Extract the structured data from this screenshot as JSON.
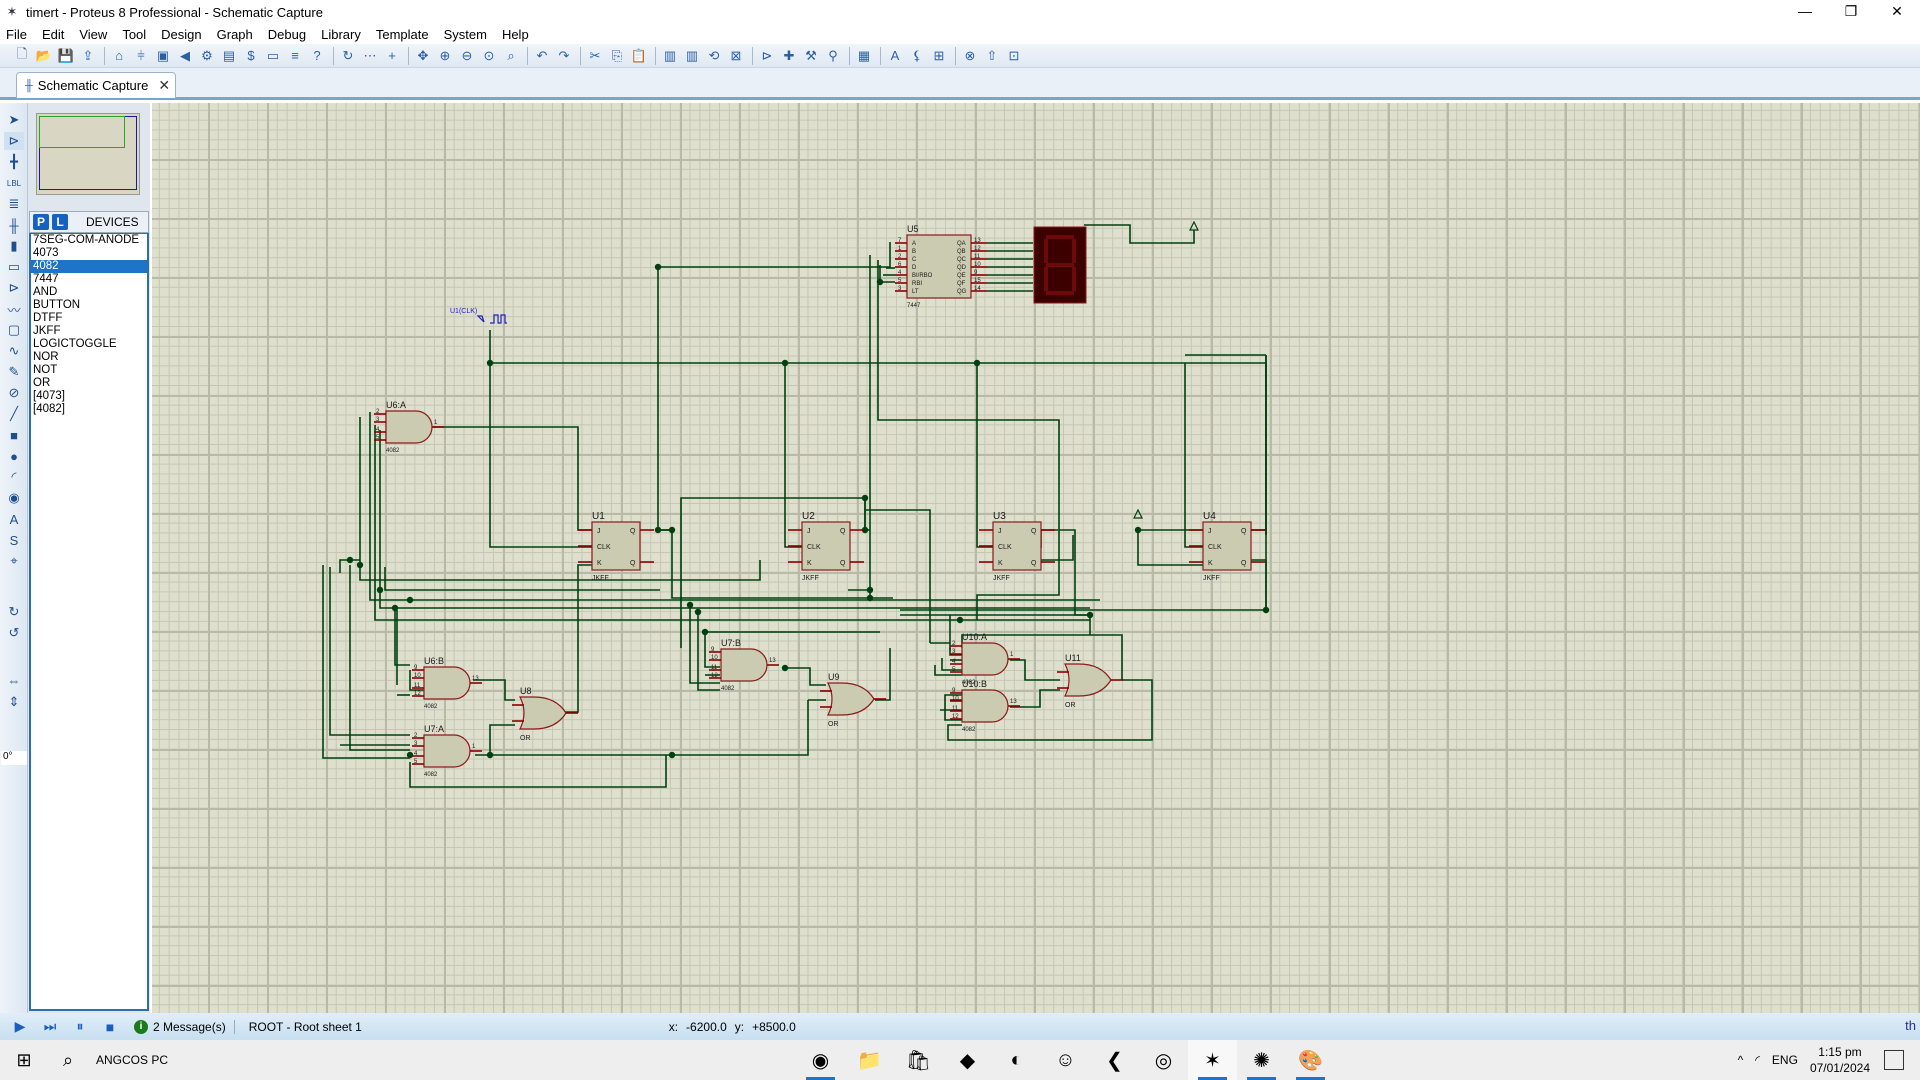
{
  "window": {
    "title": "timert - Proteus 8 Professional - Schematic Capture",
    "minimize": "—",
    "restore": "❐",
    "close": "✕"
  },
  "menu": [
    "File",
    "Edit",
    "View",
    "Tool",
    "Design",
    "Graph",
    "Debug",
    "Library",
    "Template",
    "System",
    "Help"
  ],
  "toolbar": {
    "icons": [
      "new-icon",
      "open-icon",
      "save-icon",
      "import-icon",
      "home-icon",
      "schematic-icon",
      "pcb-icon",
      "3d-icon",
      "gerber-icon",
      "bom-icon",
      "design-notes-icon",
      "design-explorer-icon",
      "report-icon",
      "help-icon",
      "refresh-icon",
      "grid-icon",
      "origin-icon",
      "pan-icon",
      "zoom-in-icon",
      "zoom-out-icon",
      "zoom-all-icon",
      "zoom-area-icon",
      "undo-icon",
      "redo-icon",
      "cut-icon",
      "copy-icon",
      "paste-icon",
      "block-copy-icon",
      "block-move-icon",
      "block-rotate-icon",
      "block-delete-icon",
      "pick-device-icon",
      "make-device-icon",
      "packaging-tool-icon",
      "decompose-icon",
      "wire-autorouter-icon",
      "search-tag-icon",
      "property-assign-icon",
      "new-sheet-icon",
      "remove-sheet-icon",
      "exit-parent-icon",
      "netlist-icon"
    ],
    "glyphs": [
      "🗋",
      "📂",
      "💾",
      "⇪",
      "⌂",
      "⫩",
      "▣",
      "◀",
      "⚙",
      "▤",
      "$",
      "▭",
      "≡",
      "?",
      "↻",
      "⋯",
      "+",
      "✥",
      "⊕",
      "⊖",
      "⊙",
      "⌕",
      "↶",
      "↷",
      "✂",
      "⎘",
      "📋",
      "▥",
      "▥",
      "⟲",
      "⊠",
      "⊳",
      "✚",
      "⚒",
      "⚲",
      "▦",
      "A",
      "⚸",
      "⊞",
      "⊗",
      "⇧",
      "⊡"
    ]
  },
  "tab": {
    "label": "Schematic Capture",
    "close": "✕"
  },
  "left_tools": [
    "selection-mode-icon",
    "component-mode-icon",
    "junction-dot-icon",
    "wire-label-icon",
    "text-script-icon",
    "bus-icon",
    "subcircuit-icon",
    "terminals-icon",
    "device-pins-icon",
    "graph-icon",
    "active-popup-icon",
    "generator-icon",
    "voltage-probe-icon",
    "virtual-instrument-icon",
    "2d-line-icon",
    "2d-box-icon",
    "2d-circle-icon",
    "2d-arc-icon",
    "2d-path-icon",
    "2d-text-icon",
    "2d-symbol-icon",
    "2d-marker-icon",
    "rotate-cw-icon",
    "rotate-ccw-icon",
    "mirror-x-icon",
    "mirror-y-icon"
  ],
  "left_tool_glyphs": [
    "➤",
    "⊳",
    "╋",
    "LBL",
    "≣",
    "╫",
    "▮",
    "▭",
    "⊳",
    "〰",
    "▢",
    "∿",
    "✎",
    "⊘",
    "╱",
    "■",
    "●",
    "◜",
    "◉",
    "A",
    "S",
    "⌖",
    "↻",
    "↺",
    "⇔",
    "⇕"
  ],
  "rotation": "0°",
  "devices": {
    "p_button": "P",
    "l_button": "L",
    "header": "DEVICES",
    "items": [
      "7SEG-COM-ANODE",
      "4073",
      "4082",
      "7447",
      "AND",
      "BUTTON",
      "DTFF",
      "JKFF",
      "LOGICTOGGLE",
      "NOR",
      "NOT",
      "OR",
      "[4073]",
      "[4082]"
    ],
    "selected": "4082"
  },
  "schematic": {
    "clock_label": "U1(CLK)",
    "flipflops": [
      {
        "ref": "U1",
        "type": "JKFF"
      },
      {
        "ref": "U2",
        "type": "JKFF"
      },
      {
        "ref": "U3",
        "type": "JKFF"
      },
      {
        "ref": "U4",
        "type": "JKFF"
      }
    ],
    "ff_pins": {
      "j": "J",
      "clk": "CLK",
      "k": "K",
      "q": "Q",
      "qbar": "Q"
    },
    "and_gates": [
      {
        "ref": "U6:A",
        "type": "4082",
        "pins": [
          "2",
          "3",
          "4",
          "5"
        ],
        "out": "1"
      },
      {
        "ref": "U6:B",
        "type": "4082",
        "pins": [
          "9",
          "10",
          "11",
          "12"
        ],
        "out": "13"
      },
      {
        "ref": "U7:A",
        "type": "4082",
        "pins": [
          "2",
          "3",
          "4",
          "5"
        ],
        "out": "1"
      },
      {
        "ref": "U7:B",
        "type": "4082",
        "pins": [
          "9",
          "10",
          "11",
          "12"
        ],
        "out": "13"
      },
      {
        "ref": "U10:A",
        "type": "4082",
        "pins": [
          "2",
          "3",
          "4",
          "5"
        ],
        "out": "1"
      },
      {
        "ref": "U10:B",
        "type": "4082",
        "pins": [
          "9",
          "10",
          "11",
          "12"
        ],
        "out": "13"
      }
    ],
    "or_gates": [
      {
        "ref": "U8",
        "type": "OR"
      },
      {
        "ref": "U9",
        "type": "OR"
      },
      {
        "ref": "U11",
        "type": "OR"
      }
    ],
    "decoder": {
      "ref": "U5",
      "type": "7447",
      "inputs": [
        {
          "n": "7",
          "l": "A"
        },
        {
          "n": "1",
          "l": "B"
        },
        {
          "n": "2",
          "l": "C"
        },
        {
          "n": "6",
          "l": "D"
        },
        {
          "n": "4",
          "l": "BI/RBO"
        },
        {
          "n": "5",
          "l": "RBI"
        },
        {
          "n": "3",
          "l": "LT"
        }
      ],
      "outputs": [
        {
          "n": "13",
          "l": "QA"
        },
        {
          "n": "12",
          "l": "QB"
        },
        {
          "n": "11",
          "l": "QC"
        },
        {
          "n": "10",
          "l": "QD"
        },
        {
          "n": "9",
          "l": "QE"
        },
        {
          "n": "15",
          "l": "QF"
        },
        {
          "n": "14",
          "l": "QG"
        }
      ]
    },
    "display": {
      "type": "7SEG-COM-ANODE"
    },
    "colors": {
      "wire": "#00400f",
      "pin": "#8b0000",
      "body": "#cbcbb1",
      "outline": "#8b1a1a",
      "label": "#1a1a1a",
      "probe": "#2020c0",
      "display_bg": "#3c0000",
      "segment": "#6a0a0a"
    }
  },
  "status": {
    "messages": "2 Message(s)",
    "sheet": "ROOT - Root sheet 1",
    "x_label": "x:",
    "x_value": "-6200.0",
    "y_label": "y:",
    "y_value": "+8500.0",
    "units": "th"
  },
  "taskbar": {
    "pc_name": "ANGCOS PC",
    "apps": [
      "edge-icon",
      "file-explorer-icon",
      "store-icon",
      "visual-studio-icon",
      "eclipse-icon",
      "godot-icon",
      "vscode-icon",
      "chrome-icon",
      "proteus-isis-icon",
      "proteus-ares-icon",
      "paint-icon"
    ],
    "app_glyphs": [
      "◉",
      "📁",
      "🛍",
      "◆",
      "◐",
      "☺",
      "❮",
      "◎",
      "✶",
      "✺",
      "🎨"
    ],
    "tray": {
      "chevron": "^",
      "wifi": "◜",
      "lang": "ENG",
      "time": "1:15 pm",
      "date": "07/01/2024"
    }
  }
}
